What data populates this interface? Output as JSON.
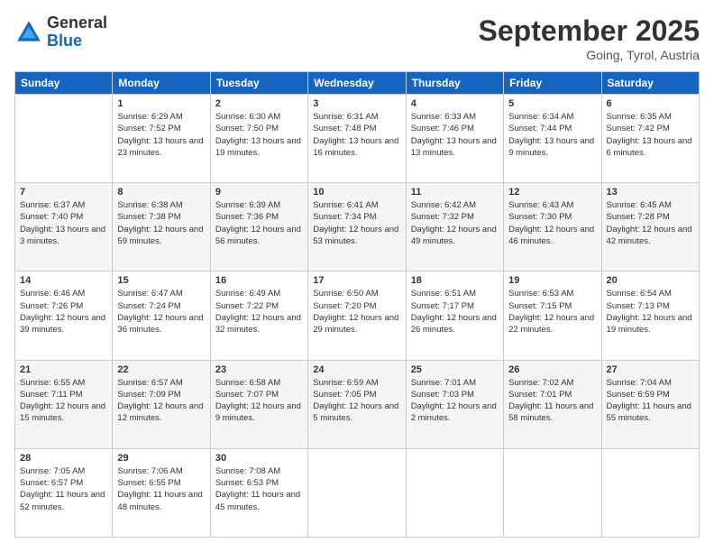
{
  "logo": {
    "general": "General",
    "blue": "Blue"
  },
  "header": {
    "month": "September 2025",
    "location": "Going, Tyrol, Austria"
  },
  "weekdays": [
    "Sunday",
    "Monday",
    "Tuesday",
    "Wednesday",
    "Thursday",
    "Friday",
    "Saturday"
  ],
  "weeks": [
    [
      {
        "day": "",
        "sunrise": "",
        "sunset": "",
        "daylight": ""
      },
      {
        "day": "1",
        "sunrise": "Sunrise: 6:29 AM",
        "sunset": "Sunset: 7:52 PM",
        "daylight": "Daylight: 13 hours and 23 minutes."
      },
      {
        "day": "2",
        "sunrise": "Sunrise: 6:30 AM",
        "sunset": "Sunset: 7:50 PM",
        "daylight": "Daylight: 13 hours and 19 minutes."
      },
      {
        "day": "3",
        "sunrise": "Sunrise: 6:31 AM",
        "sunset": "Sunset: 7:48 PM",
        "daylight": "Daylight: 13 hours and 16 minutes."
      },
      {
        "day": "4",
        "sunrise": "Sunrise: 6:33 AM",
        "sunset": "Sunset: 7:46 PM",
        "daylight": "Daylight: 13 hours and 13 minutes."
      },
      {
        "day": "5",
        "sunrise": "Sunrise: 6:34 AM",
        "sunset": "Sunset: 7:44 PM",
        "daylight": "Daylight: 13 hours and 9 minutes."
      },
      {
        "day": "6",
        "sunrise": "Sunrise: 6:35 AM",
        "sunset": "Sunset: 7:42 PM",
        "daylight": "Daylight: 13 hours and 6 minutes."
      }
    ],
    [
      {
        "day": "7",
        "sunrise": "Sunrise: 6:37 AM",
        "sunset": "Sunset: 7:40 PM",
        "daylight": "Daylight: 13 hours and 3 minutes."
      },
      {
        "day": "8",
        "sunrise": "Sunrise: 6:38 AM",
        "sunset": "Sunset: 7:38 PM",
        "daylight": "Daylight: 12 hours and 59 minutes."
      },
      {
        "day": "9",
        "sunrise": "Sunrise: 6:39 AM",
        "sunset": "Sunset: 7:36 PM",
        "daylight": "Daylight: 12 hours and 56 minutes."
      },
      {
        "day": "10",
        "sunrise": "Sunrise: 6:41 AM",
        "sunset": "Sunset: 7:34 PM",
        "daylight": "Daylight: 12 hours and 53 minutes."
      },
      {
        "day": "11",
        "sunrise": "Sunrise: 6:42 AM",
        "sunset": "Sunset: 7:32 PM",
        "daylight": "Daylight: 12 hours and 49 minutes."
      },
      {
        "day": "12",
        "sunrise": "Sunrise: 6:43 AM",
        "sunset": "Sunset: 7:30 PM",
        "daylight": "Daylight: 12 hours and 46 minutes."
      },
      {
        "day": "13",
        "sunrise": "Sunrise: 6:45 AM",
        "sunset": "Sunset: 7:28 PM",
        "daylight": "Daylight: 12 hours and 42 minutes."
      }
    ],
    [
      {
        "day": "14",
        "sunrise": "Sunrise: 6:46 AM",
        "sunset": "Sunset: 7:26 PM",
        "daylight": "Daylight: 12 hours and 39 minutes."
      },
      {
        "day": "15",
        "sunrise": "Sunrise: 6:47 AM",
        "sunset": "Sunset: 7:24 PM",
        "daylight": "Daylight: 12 hours and 36 minutes."
      },
      {
        "day": "16",
        "sunrise": "Sunrise: 6:49 AM",
        "sunset": "Sunset: 7:22 PM",
        "daylight": "Daylight: 12 hours and 32 minutes."
      },
      {
        "day": "17",
        "sunrise": "Sunrise: 6:50 AM",
        "sunset": "Sunset: 7:20 PM",
        "daylight": "Daylight: 12 hours and 29 minutes."
      },
      {
        "day": "18",
        "sunrise": "Sunrise: 6:51 AM",
        "sunset": "Sunset: 7:17 PM",
        "daylight": "Daylight: 12 hours and 26 minutes."
      },
      {
        "day": "19",
        "sunrise": "Sunrise: 6:53 AM",
        "sunset": "Sunset: 7:15 PM",
        "daylight": "Daylight: 12 hours and 22 minutes."
      },
      {
        "day": "20",
        "sunrise": "Sunrise: 6:54 AM",
        "sunset": "Sunset: 7:13 PM",
        "daylight": "Daylight: 12 hours and 19 minutes."
      }
    ],
    [
      {
        "day": "21",
        "sunrise": "Sunrise: 6:55 AM",
        "sunset": "Sunset: 7:11 PM",
        "daylight": "Daylight: 12 hours and 15 minutes."
      },
      {
        "day": "22",
        "sunrise": "Sunrise: 6:57 AM",
        "sunset": "Sunset: 7:09 PM",
        "daylight": "Daylight: 12 hours and 12 minutes."
      },
      {
        "day": "23",
        "sunrise": "Sunrise: 6:58 AM",
        "sunset": "Sunset: 7:07 PM",
        "daylight": "Daylight: 12 hours and 9 minutes."
      },
      {
        "day": "24",
        "sunrise": "Sunrise: 6:59 AM",
        "sunset": "Sunset: 7:05 PM",
        "daylight": "Daylight: 12 hours and 5 minutes."
      },
      {
        "day": "25",
        "sunrise": "Sunrise: 7:01 AM",
        "sunset": "Sunset: 7:03 PM",
        "daylight": "Daylight: 12 hours and 2 minutes."
      },
      {
        "day": "26",
        "sunrise": "Sunrise: 7:02 AM",
        "sunset": "Sunset: 7:01 PM",
        "daylight": "Daylight: 11 hours and 58 minutes."
      },
      {
        "day": "27",
        "sunrise": "Sunrise: 7:04 AM",
        "sunset": "Sunset: 6:59 PM",
        "daylight": "Daylight: 11 hours and 55 minutes."
      }
    ],
    [
      {
        "day": "28",
        "sunrise": "Sunrise: 7:05 AM",
        "sunset": "Sunset: 6:57 PM",
        "daylight": "Daylight: 11 hours and 52 minutes."
      },
      {
        "day": "29",
        "sunrise": "Sunrise: 7:06 AM",
        "sunset": "Sunset: 6:55 PM",
        "daylight": "Daylight: 11 hours and 48 minutes."
      },
      {
        "day": "30",
        "sunrise": "Sunrise: 7:08 AM",
        "sunset": "Sunset: 6:53 PM",
        "daylight": "Daylight: 11 hours and 45 minutes."
      },
      {
        "day": "",
        "sunrise": "",
        "sunset": "",
        "daylight": ""
      },
      {
        "day": "",
        "sunrise": "",
        "sunset": "",
        "daylight": ""
      },
      {
        "day": "",
        "sunrise": "",
        "sunset": "",
        "daylight": ""
      },
      {
        "day": "",
        "sunrise": "",
        "sunset": "",
        "daylight": ""
      }
    ]
  ]
}
